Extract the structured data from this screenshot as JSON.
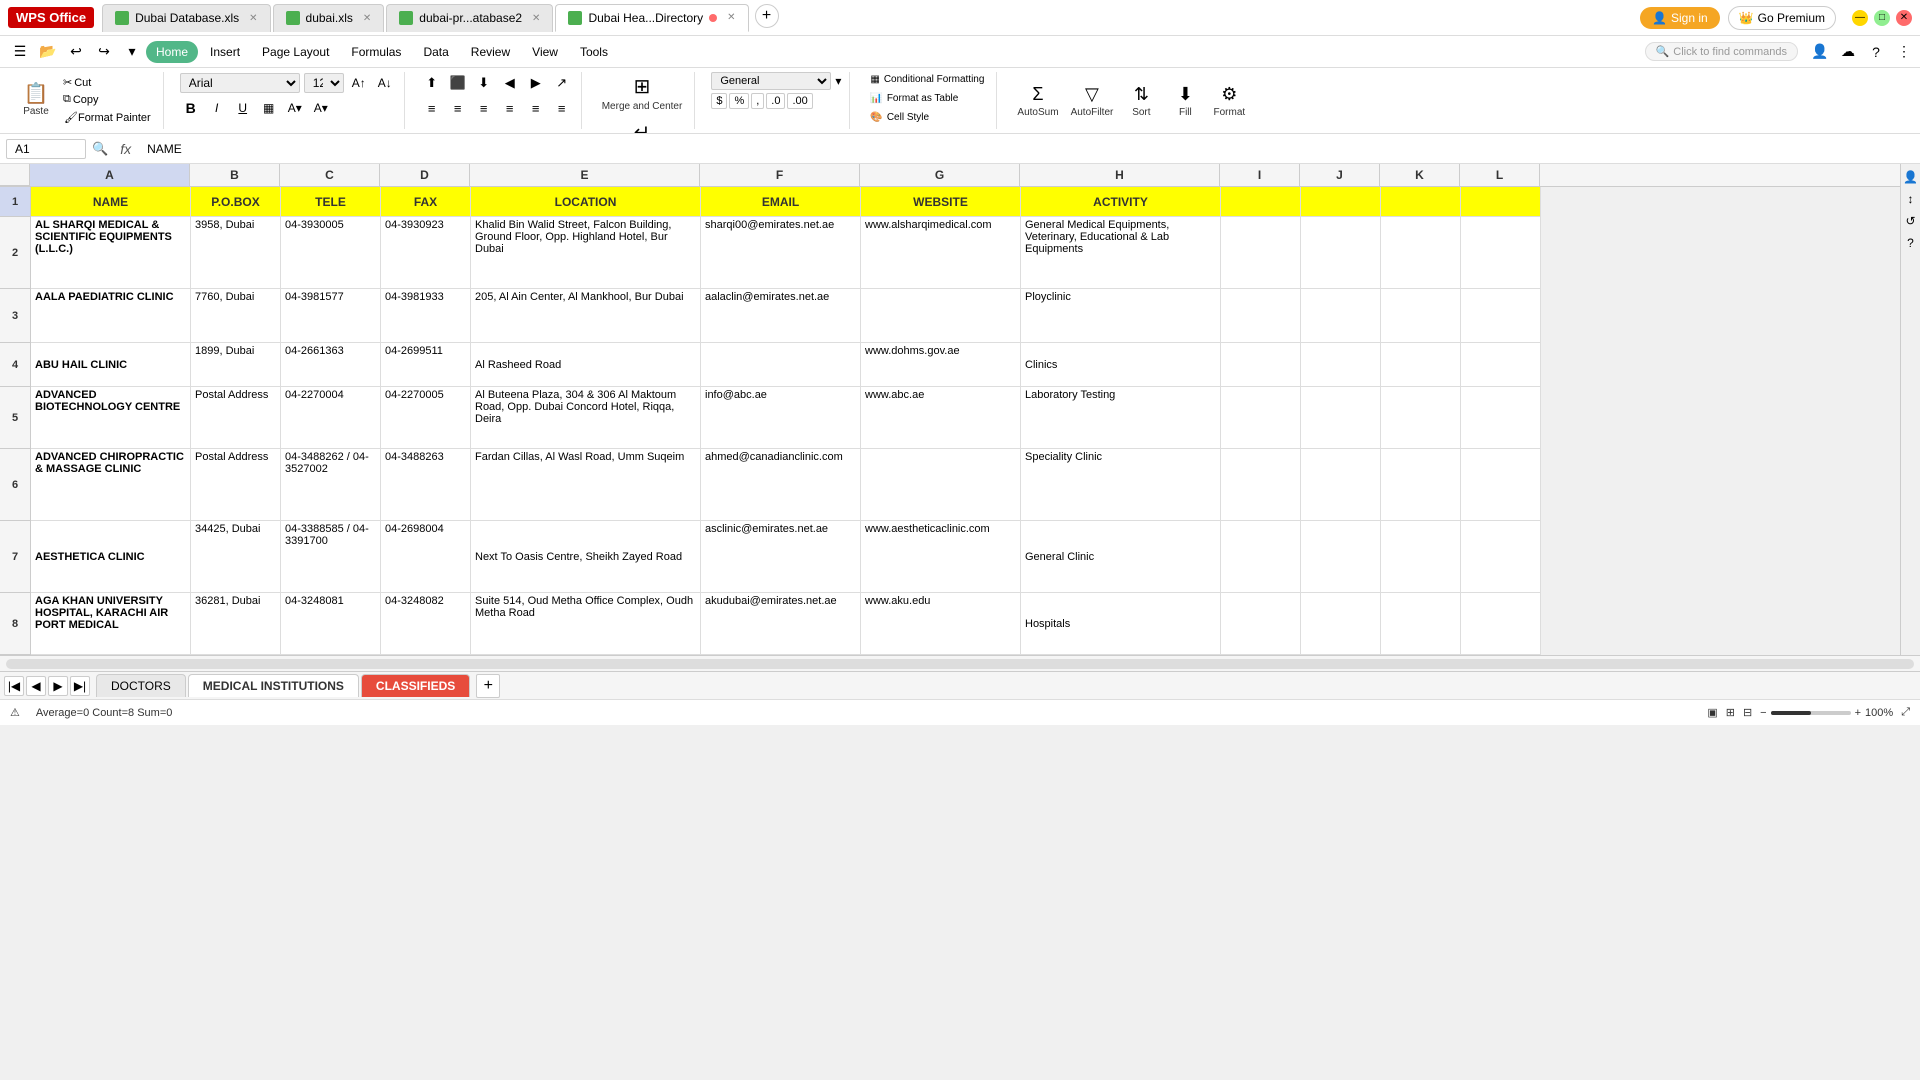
{
  "titlebar": {
    "wps_label": "WPS Office",
    "tabs": [
      {
        "label": "Dubai Database.xls",
        "type": "green",
        "active": false
      },
      {
        "label": "dubai.xls",
        "type": "green",
        "active": false
      },
      {
        "label": "dubai-pr...atabase2",
        "type": "green",
        "active": false
      },
      {
        "label": "Dubai Hea...Directory",
        "type": "green",
        "active": true
      }
    ],
    "sign_in": "Sign in",
    "go_premium": "Go Premium"
  },
  "menubar": {
    "menu_btn": "☰ Menu",
    "items": [
      "Home",
      "Insert",
      "Page Layout",
      "Formulas",
      "Data",
      "Review",
      "View",
      "Tools"
    ],
    "search_placeholder": "Click to find commands"
  },
  "ribbon": {
    "paste_label": "Paste",
    "cut_label": "Cut",
    "copy_label": "Copy",
    "format_painter_label": "Format Painter",
    "font_name": "Arial",
    "font_size": "12",
    "bold": "B",
    "italic": "I",
    "underline": "U",
    "merge_center_label": "Merge and Center",
    "wrap_text_label": "Wrap Text",
    "number_format": "General",
    "conditional_formatting_label": "Conditional Formatting",
    "format_as_table_label": "Format as Table",
    "cell_style_label": "Cell Style",
    "autosum_label": "AutoSum",
    "autofilter_label": "AutoFilter",
    "sort_label": "Sort",
    "fill_label": "Fill",
    "format_label": "Format"
  },
  "formulabar": {
    "cell_ref": "A1",
    "fx": "fx",
    "formula": "NAME"
  },
  "columns": [
    "A",
    "B",
    "C",
    "D",
    "E",
    "F",
    "G",
    "H",
    "I",
    "J",
    "K",
    "L"
  ],
  "rows": [
    1,
    2,
    3,
    4,
    5,
    6,
    7,
    8
  ],
  "header": {
    "cols": [
      "NAME",
      "P.O.BOX",
      "TELE",
      "FAX",
      "LOCATION",
      "EMAIL",
      "WEBSITE",
      "ACTIVITY"
    ]
  },
  "data": [
    {
      "row": 2,
      "name": "AL SHARQI MEDICAL & SCIENTIFIC EQUIPMENTS (L.L.C.)",
      "pobox": "3958, Dubai",
      "tele": "04-3930005",
      "fax": "04-3930923",
      "location": "Khalid Bin Walid Street, Falcon Building, Ground Floor, Opp. Highland Hotel, Bur Dubai",
      "email": "sharqi00@emirates.net.ae",
      "website": "www.alsharqimedical.com",
      "activity": "General Medical Equipments, Veterinary, Educational & Lab Equipments"
    },
    {
      "row": 3,
      "name": "AALA PAEDIATRIC CLINIC",
      "pobox": "7760, Dubai",
      "tele": "04-3981577",
      "fax": "04-3981933",
      "location": "205, Al Ain Center, Al Mankhool, Bur Dubai",
      "email": "aalaclin@emirates.net.ae",
      "website": "",
      "activity": "Ployclinic"
    },
    {
      "row": 4,
      "name": "ABU HAIL CLINIC",
      "pobox": "1899, Dubai",
      "tele": "04-2661363",
      "fax": "04-2699511",
      "location": "Al Rasheed Road",
      "email": "",
      "website": "www.dohms.gov.ae",
      "activity": "Clinics"
    },
    {
      "row": 5,
      "name": "ADVANCED BIOTECHNOLOGY CENTRE",
      "pobox": "Postal Address",
      "tele": "04-2270004",
      "fax": "04-2270005",
      "location": "Al Buteena Plaza, 304 & 306 Al Maktoum Road, Opp. Dubai Concord Hotel, Riqqa, Deira",
      "email": "info@abc.ae",
      "website": "www.abc.ae",
      "activity": "Laboratory Testing"
    },
    {
      "row": 6,
      "name": "ADVANCED CHIROPRACTIC & MASSAGE CLINIC",
      "pobox": "Postal Address",
      "tele": "04-3488262 / 04-3527002",
      "fax": "04-3488263",
      "location": "Fardan Cillas, Al Wasl Road, Umm Suqeim",
      "email": "ahmed@canadianclinic.com",
      "website": "",
      "activity": "Speciality Clinic"
    },
    {
      "row": 7,
      "name": "AESTHETICA CLINIC",
      "pobox": "34425, Dubai",
      "tele": "04-3388585 / 04-3391700",
      "fax": "04-2698004",
      "location": "Next To Oasis Centre, Sheikh Zayed Road",
      "email": "asclinic@emirates.net.ae",
      "website": "www.aestheticaclinic.com",
      "activity": "General Clinic"
    },
    {
      "row": 8,
      "name": "AGA KHAN UNIVERSITY HOSPITAL, KARACHI AIR PORT MEDICAL",
      "pobox": "36281, Dubai",
      "tele": "04-3248081",
      "fax": "04-3248082",
      "location": "Suite 514, Oud Metha Office Complex, Oudh Metha Road",
      "email": "akudubai@emirates.net.ae",
      "website": "www.aku.edu",
      "activity": "Hospitals"
    }
  ],
  "sheets": [
    {
      "label": "DOCTORS",
      "active": false,
      "color": "normal"
    },
    {
      "label": "MEDICAL INSTITUTIONS",
      "active": true,
      "color": "normal"
    },
    {
      "label": "CLASSIFIEDS",
      "active": false,
      "color": "red"
    }
  ],
  "statusbar": {
    "stats": "Average=0  Count=8  Sum=0",
    "zoom": "100%"
  }
}
